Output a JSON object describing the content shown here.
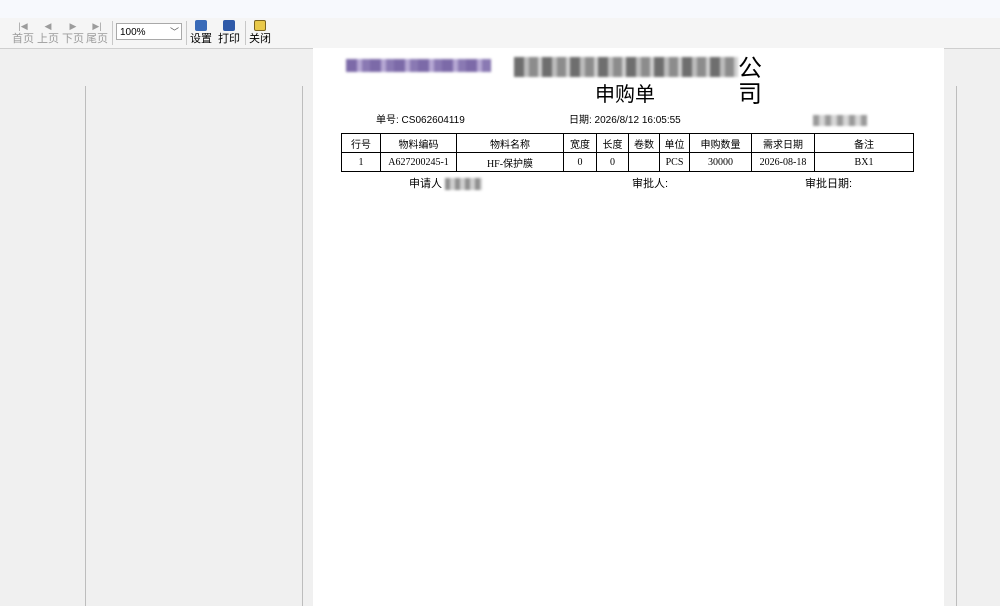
{
  "toolbar": {
    "buttons": {
      "first": "首页",
      "prev": "上页",
      "next": "下页",
      "last": "尾页",
      "settings": "设置",
      "print": "打印",
      "close": "关闭"
    },
    "zoom": "100%"
  },
  "document": {
    "company_suffix": "公司",
    "title": "申购单",
    "order_no": "单号: CS062604119",
    "date": "日期: 2026/8/12 16:05:55",
    "columns": [
      "行号",
      "物料编码",
      "物料名称",
      "宽度",
      "长度",
      "卷数",
      "单位",
      "申购数量",
      "需求日期",
      "备注"
    ],
    "rows": [
      [
        "1",
        "A627200245-1",
        "HF-保护膜",
        "0",
        "0",
        "",
        "PCS",
        "30000",
        "2026-08-18",
        "BX1"
      ]
    ],
    "applicant_label": "申请人",
    "approver_label": "审批人:",
    "approval_date_label": "审批日期:"
  }
}
